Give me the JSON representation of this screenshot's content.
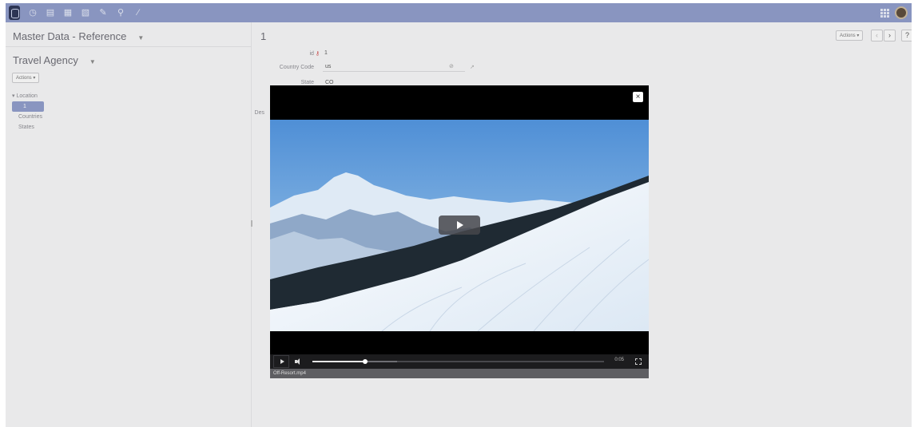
{
  "topbar": {
    "icons": [
      "database-icon",
      "clock-icon",
      "document-icon",
      "documents-icon",
      "document-edit-icon",
      "pin-icon",
      "search-icon",
      "wand-icon"
    ],
    "apps_icon": "grid-icon",
    "avatar": "user-avatar"
  },
  "left": {
    "title": "Master Data - Reference",
    "agency": "Travel Agency",
    "actions_label": "Actions ▾",
    "tree": {
      "root": "▾ Location",
      "selected": "1",
      "items": [
        "Countries",
        "States"
      ]
    }
  },
  "record": {
    "title": "1",
    "actions_label": "Actions ▾",
    "prev": "‹",
    "next": "›",
    "help": "?",
    "fields": {
      "id_label": "id",
      "id_value": "1",
      "country_label": "Country Code",
      "country_value": "us",
      "state_label": "State",
      "state_value": "CO",
      "desc_label": "Des"
    }
  },
  "video": {
    "close": "×",
    "time": "0:05",
    "caption": "Off-Resort.mp4",
    "progress": 0.18,
    "buffered": 0.29
  },
  "colors": {
    "accent": "#8e9bc8",
    "sky": "#5a96d8",
    "snow": "#f2f6fb"
  }
}
